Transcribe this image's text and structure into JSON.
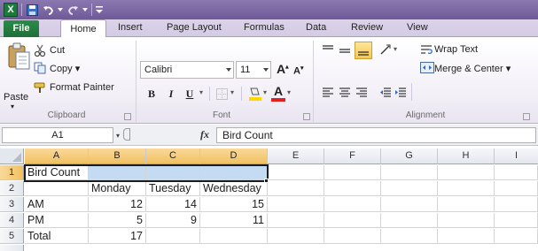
{
  "title_bar": {
    "quick_access": [
      "save-icon",
      "undo-icon",
      "redo-icon",
      "customize-icon"
    ],
    "app_icon_letter": "X"
  },
  "tabs": {
    "file": "File",
    "items": [
      "Home",
      "Insert",
      "Page Layout",
      "Formulas",
      "Data",
      "Review",
      "View"
    ]
  },
  "ribbon": {
    "clipboard": {
      "paste": "Paste",
      "cut": "Cut",
      "copy": "Copy ▾",
      "format_painter": "Format Painter",
      "label": "Clipboard"
    },
    "font": {
      "font_name": "Calibri",
      "font_size": "11",
      "bold": "B",
      "italic": "I",
      "underline": "U",
      "grow": "A",
      "shrink": "A",
      "label": "Font"
    },
    "alignment": {
      "wrap_text": "Wrap Text",
      "merge_center": "Merge & Center ▾",
      "label": "Alignment"
    }
  },
  "formula_bar": {
    "name_box": "A1",
    "fx": "fx",
    "content": "Bird Count"
  },
  "sheet": {
    "columns": [
      "A",
      "B",
      "C",
      "D",
      "E",
      "F",
      "G",
      "H",
      "I"
    ],
    "rows": [
      "1",
      "2",
      "3",
      "4",
      "5"
    ],
    "cells": {
      "A1": "Bird Count",
      "B2": "Monday",
      "C2": "Tuesday",
      "D2": "Wednesday",
      "A3": "AM",
      "B3": "12",
      "C3": "14",
      "D3": "15",
      "A4": "PM",
      "B4": "5",
      "C4": "9",
      "D4": "11",
      "A5": "Total",
      "B5": "17"
    }
  },
  "colors": {
    "selection_fill": "#c5dbf1",
    "header_highlight": "#f1c15f",
    "file_tab": "#1f6f38"
  }
}
